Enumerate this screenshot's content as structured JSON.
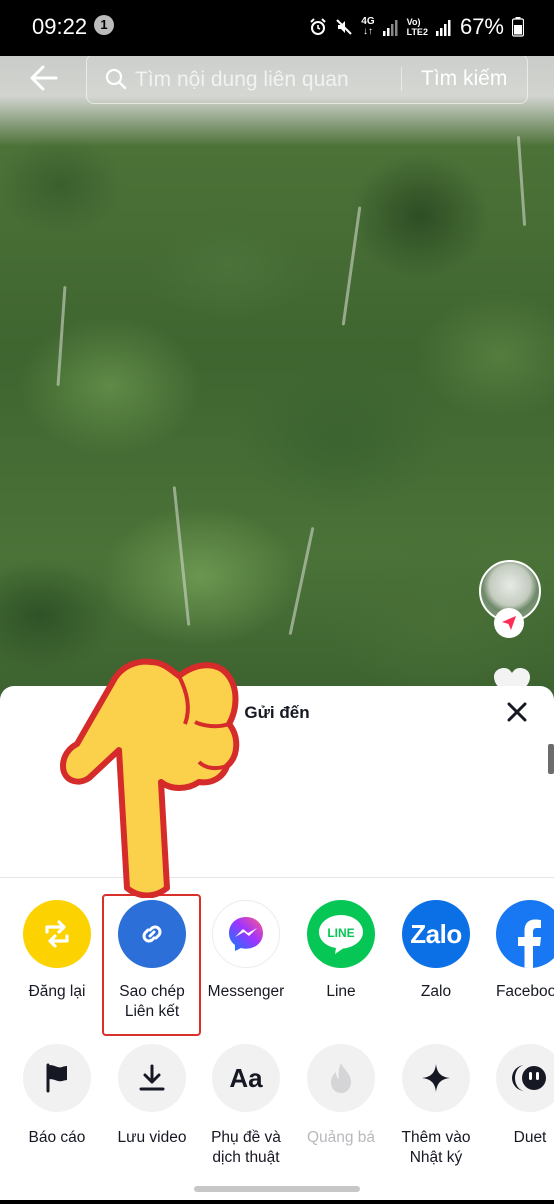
{
  "status_bar": {
    "time": "09:22",
    "notification_count": "1",
    "network_top": "4G",
    "network_bottom": "VoLTE2",
    "battery": "67%"
  },
  "search": {
    "placeholder": "Tìm nội dung liên quan",
    "submit_label": "Tìm kiếm"
  },
  "share_sheet": {
    "title": "Gửi đến",
    "share_targets": [
      {
        "label": "Đăng lại",
        "icon": "repost-icon",
        "color": "#fcd200"
      },
      {
        "label_line1": "Sao chép",
        "label_line2": "Liên kết",
        "icon": "link-icon",
        "color": "#2d6fd8"
      },
      {
        "label": "Messenger",
        "icon": "messenger-icon",
        "color": "#a033ff"
      },
      {
        "label": "Line",
        "icon": "line-icon",
        "color": "#06c755"
      },
      {
        "label": "Zalo",
        "icon_text": "Zalo",
        "icon": "zalo-icon",
        "color": "#0b6fe6"
      },
      {
        "label": "Facebook",
        "icon": "facebook-icon",
        "color": "#1877f2"
      }
    ],
    "actions": [
      {
        "label": "Báo cáo",
        "icon": "flag-icon"
      },
      {
        "label": "Lưu video",
        "icon": "download-icon"
      },
      {
        "label_line1": "Phụ đề và",
        "label_line2": "dịch thuật",
        "icon_text": "Aa",
        "icon": "captions-icon"
      },
      {
        "label": "Quảng bá",
        "icon": "promote-flame-icon",
        "disabled": true
      },
      {
        "label_line1": "Thêm vào",
        "label_line2": "Nhật ký",
        "icon": "sparkle-icon"
      },
      {
        "label": "Duet",
        "icon": "duet-icon"
      }
    ]
  }
}
